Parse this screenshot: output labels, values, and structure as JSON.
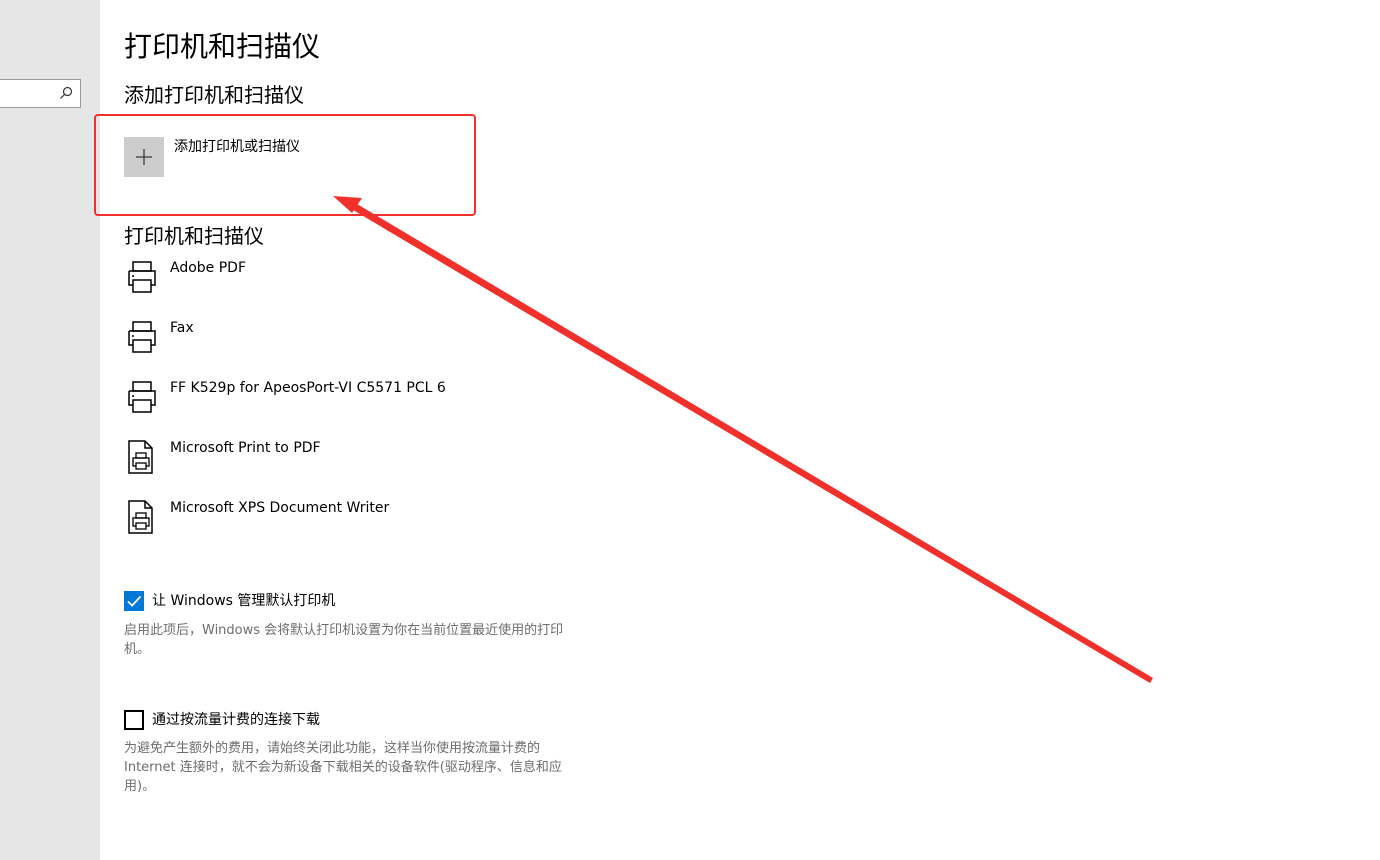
{
  "colors": {
    "accent": "#0078d7",
    "annotation": "#f0302a",
    "description_text": "#6d6d6d",
    "sidebar_bg": "#e6e6e6",
    "add_tile_bg": "#cccccc"
  },
  "sidebar": {
    "search": {
      "placeholder": "",
      "icon": "search-icon"
    }
  },
  "page": {
    "title": "打印机和扫描仪"
  },
  "add_section": {
    "heading": "添加打印机和扫描仪",
    "add_button": {
      "label": "添加打印机或扫描仪",
      "icon": "plus-icon"
    }
  },
  "devices_section": {
    "heading": "打印机和扫描仪",
    "devices": [
      {
        "name": "Adobe PDF",
        "icon": "printer-icon"
      },
      {
        "name": "Fax",
        "icon": "printer-icon"
      },
      {
        "name": "FF K529p for ApeosPort-VI C5571 PCL 6",
        "icon": "printer-icon"
      },
      {
        "name": "Microsoft Print to PDF",
        "icon": "document-printer-icon"
      },
      {
        "name": "Microsoft XPS Document Writer",
        "icon": "document-printer-icon"
      }
    ]
  },
  "options": {
    "manage_default": {
      "label": "让 Windows 管理默认打印机",
      "checked": true,
      "description": "启用此项后，Windows 会将默认打印机设置为你在当前位置最近使用的打印机。"
    },
    "metered_download": {
      "label": "通过按流量计费的连接下载",
      "checked": false,
      "description": "为避免产生额外的费用，请始终关闭此功能，这样当你使用按流量计费的 Internet 连接时，就不会为新设备下载相关的设备软件(驱动程序、信息和应用)。"
    }
  }
}
